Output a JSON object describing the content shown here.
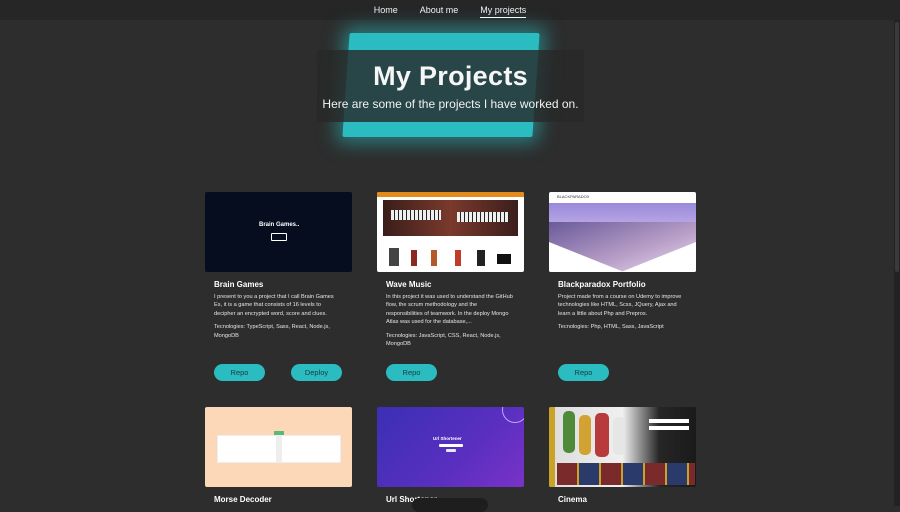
{
  "nav": {
    "items": [
      {
        "label": "Home"
      },
      {
        "label": "About me"
      },
      {
        "label": "My projects"
      }
    ]
  },
  "hero": {
    "title": "My Projects",
    "subtitle": "Here are some of the projects I have worked on."
  },
  "projects": [
    {
      "title": "Brain Games",
      "description": "I present to you a project that I call Brain Games Es, it is a game that consists of 16 levels to decipher an encrypted word, score and clues.",
      "tech": "Tecnologies: TypeScript, Sass, React, Node.js, MongoDB",
      "repo": "Repo",
      "deploy": "Deploy",
      "thumb_text": "Brain Games.."
    },
    {
      "title": "Wave Music",
      "description": "In this project it was used to understand the GitHub flow, the scrum methodology and the responsibilities of teamwork. In the deploy Mongo Atlas was used for the database,...",
      "tech": "Tecnologies: JavaScript, CSS, React, Node.js, MongoDB",
      "repo": "Repo"
    },
    {
      "title": "Blackparadox Portfolio",
      "description": "Project made from a course on Udemy to improve technologies like HTML, Scss, JQuery, Ajax and learn a little about Php and Prepros.",
      "tech": "Tecnologies: Php, HTML, Sass, JavaScript",
      "repo": "Repo",
      "thumb_text": "BLACKPARADOX"
    },
    {
      "title": "Morse Decoder"
    },
    {
      "title": "Url Shortener",
      "thumb_text": "Url Shortener"
    },
    {
      "title": "Cinema"
    }
  ],
  "colors": {
    "accent": "#2abcc0",
    "background": "#2d2d2d",
    "navbar": "#262626"
  }
}
